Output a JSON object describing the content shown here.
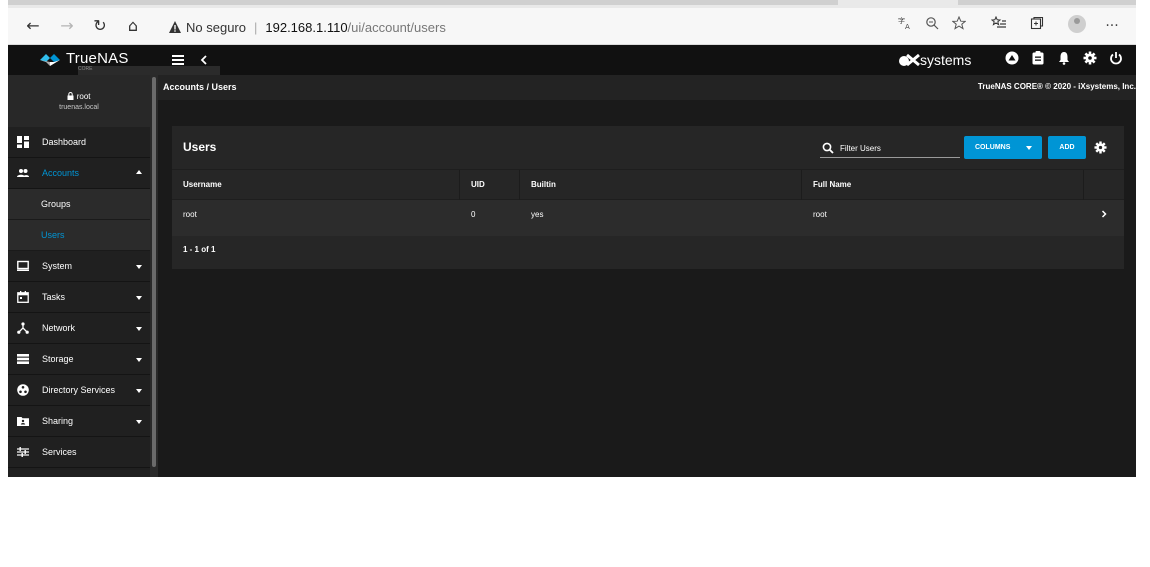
{
  "browser": {
    "back": "←",
    "forward": "→",
    "reload": "↻",
    "home": "⌂",
    "security_label": "No seguro",
    "url_host": "192.168.1.110",
    "url_path": "/ui/account/users",
    "more": "···"
  },
  "topbar": {
    "product_name": "TrueNAS",
    "product_edition": "CORE",
    "brand": "systems"
  },
  "sidebar": {
    "user": "root",
    "hostname": "truenas.local",
    "items": [
      {
        "label": "Dashboard",
        "icon": "dashboard-icon"
      },
      {
        "label": "Accounts",
        "icon": "accounts-icon",
        "expanded": true
      },
      {
        "label": "System",
        "icon": "system-icon"
      },
      {
        "label": "Tasks",
        "icon": "tasks-icon"
      },
      {
        "label": "Network",
        "icon": "network-icon"
      },
      {
        "label": "Storage",
        "icon": "storage-icon"
      },
      {
        "label": "Directory Services",
        "icon": "directory-services-icon"
      },
      {
        "label": "Sharing",
        "icon": "sharing-icon"
      },
      {
        "label": "Services",
        "icon": "services-icon"
      }
    ],
    "accounts_sub": [
      {
        "label": "Groups"
      },
      {
        "label": "Users",
        "active": true
      }
    ]
  },
  "breadcrumb": "Accounts / Users",
  "copyright": "TrueNAS CORE® © 2020 - iXsystems, Inc.",
  "users_card": {
    "title": "Users",
    "filter_placeholder": "Filter Users",
    "columns_button": "COLUMNS",
    "add_button": "ADD",
    "columns": [
      "Username",
      "UID",
      "Builtin",
      "Full Name"
    ],
    "rows": [
      {
        "username": "root",
        "uid": "0",
        "builtin": "yes",
        "full_name": "root"
      }
    ],
    "pagination": "1 - 1 of 1"
  },
  "colors": {
    "accent": "#0095d5",
    "background": "#1a1a1a",
    "card": "#262626",
    "sidebar": "#202020"
  }
}
